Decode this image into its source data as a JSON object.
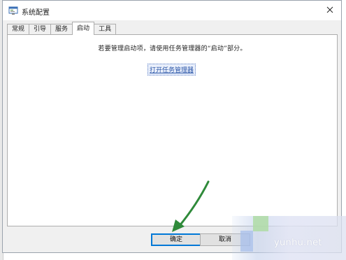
{
  "window": {
    "title": "系统配置",
    "icon": "system-config-icon",
    "close_icon": "close-icon"
  },
  "tabs": [
    {
      "label": "常规",
      "active": false
    },
    {
      "label": "引导",
      "active": false
    },
    {
      "label": "服务",
      "active": false
    },
    {
      "label": "启动",
      "active": true
    },
    {
      "label": "工具",
      "active": false
    }
  ],
  "startup_panel": {
    "message": "若要管理启动项，请使用任务管理器的“启动”部分。",
    "link_label": "打开任务管理器"
  },
  "buttons": {
    "ok_label": "确定",
    "cancel_label": "取消"
  },
  "annotation": {
    "arrow_color": "#2f8a3a"
  },
  "watermark": {
    "text": "yunhu.net"
  },
  "colors": {
    "accent": "#0078d7",
    "link": "#2b56a8"
  }
}
